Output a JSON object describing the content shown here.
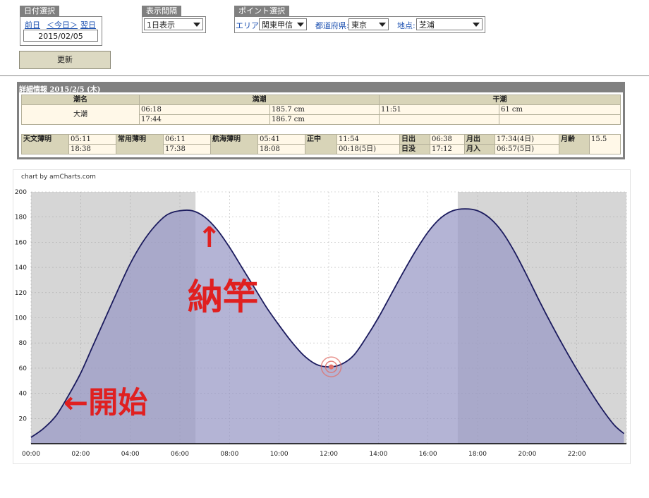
{
  "date_panel": {
    "title": "日付選択",
    "prev": "前日",
    "today": "＜今日＞",
    "next": "翌日",
    "date_value": "2015/02/05",
    "update_label": "更新"
  },
  "interval_panel": {
    "title": "表示間隔",
    "selected": "1日表示"
  },
  "point_panel": {
    "title": "ポイント選択",
    "area_label": "エリア:",
    "area_value": "関東甲信",
    "pref_label": "都道府県:",
    "pref_value": "東京",
    "spot_label": "地点:",
    "spot_value": "芝浦"
  },
  "detail": {
    "title": "詳細情報  2015/2/5 (木)",
    "headers": {
      "tide_name": "潮名",
      "high": "満潮",
      "low": "干潮"
    },
    "tide_name_value": "大潮",
    "high_rows": [
      {
        "time": "06:18",
        "level": "185.7 cm"
      },
      {
        "time": "17:44",
        "level": "186.7 cm"
      }
    ],
    "low_rows": [
      {
        "time": "11:51",
        "level": "61 cm"
      }
    ],
    "twilight": {
      "astro_label": "天文薄明",
      "astro_1": "05:11",
      "astro_2": "18:38",
      "civil_label": "常用薄明",
      "civil_1": "06:11",
      "civil_2": "17:38",
      "naut_label": "航海薄明",
      "naut_1": "05:41",
      "naut_2": "18:08",
      "noon_label": "正中",
      "noon_1": "11:54",
      "noon_2": "00:18(5日)",
      "sunrise_label": "日出",
      "sunrise_value": "06:38",
      "sunset_label": "日没",
      "sunset_value": "17:12",
      "moonrise_label": "月出",
      "moonrise_value": "17:34(4日)",
      "moonset_label": "月入",
      "moonset_value": "06:57(5日)",
      "moonage_label": "月齢",
      "moonage_value": "15.5"
    }
  },
  "chart_credit": "chart by amCharts.com",
  "annotations": {
    "start": "←開始",
    "end_arrow": "↑",
    "end": "納竿"
  },
  "colors": {
    "night": "#d6d6d6",
    "fill": "#9797c5",
    "line": "#1b1b5e",
    "grid": "#9a9a9a",
    "marker": "#e0706a",
    "annotation": "#e02020"
  },
  "chart_data": {
    "type": "area",
    "x_unit": "hours",
    "x": [
      0,
      0.5,
      1,
      1.5,
      2,
      2.5,
      3,
      3.5,
      4,
      4.5,
      5,
      5.5,
      6,
      6.5,
      7,
      7.5,
      8,
      8.5,
      9,
      9.5,
      10,
      10.5,
      11,
      11.5,
      12,
      12.5,
      13,
      13.5,
      14,
      14.5,
      15,
      15.5,
      16,
      16.5,
      17,
      17.5,
      18,
      18.5,
      19,
      19.5,
      20,
      20.5,
      21,
      21.5,
      22,
      22.5,
      23,
      23.5,
      23.9
    ],
    "y": [
      5,
      12,
      22,
      38,
      56,
      78,
      100,
      122,
      143,
      160,
      173,
      182,
      185,
      185,
      180,
      170,
      156,
      140,
      124,
      108,
      94,
      81,
      70,
      63,
      61,
      63,
      70,
      84,
      100,
      118,
      136,
      153,
      168,
      179,
      185,
      186.5,
      185,
      179,
      168,
      152,
      133,
      113,
      94,
      76,
      59,
      43,
      28,
      15,
      8
    ],
    "x_ticks": [
      "00:00",
      "02:00",
      "04:00",
      "06:00",
      "08:00",
      "10:00",
      "12:00",
      "14:00",
      "16:00",
      "18:00",
      "20:00",
      "22:00"
    ],
    "y_ticks": [
      20,
      40,
      60,
      80,
      100,
      120,
      140,
      160,
      180,
      200
    ],
    "xlim": [
      0,
      24
    ],
    "ylim": [
      0,
      200
    ],
    "grid": true,
    "night_shading": [
      [
        0,
        6.63
      ],
      [
        17.2,
        24
      ]
    ],
    "marker": {
      "x": 12.1,
      "y": 61
    }
  }
}
